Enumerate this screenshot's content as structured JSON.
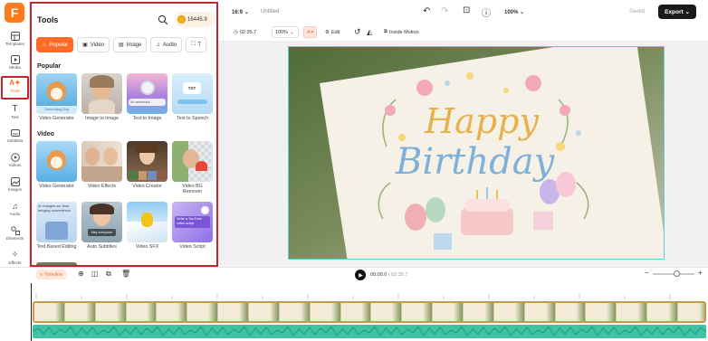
{
  "rail": {
    "items": [
      {
        "label": "Templates",
        "icon": "templates-icon"
      },
      {
        "label": "Media",
        "icon": "media-icon"
      },
      {
        "label": "Tools",
        "icon": "ai-tools-icon"
      },
      {
        "label": "Text",
        "icon": "text-icon"
      },
      {
        "label": "Subtitles",
        "icon": "subtitles-icon"
      },
      {
        "label": "Videos",
        "icon": "videos-icon"
      },
      {
        "label": "Images",
        "icon": "images-icon"
      },
      {
        "label": "Audio",
        "icon": "audio-icon"
      },
      {
        "label": "Elements",
        "icon": "elements-icon"
      },
      {
        "label": "Effects",
        "icon": "effects-icon"
      },
      {
        "label": "Brand",
        "icon": "brand-icon"
      }
    ]
  },
  "tools": {
    "title": "Tools",
    "credits": "16445.9",
    "tabs": [
      "Popular",
      "Video",
      "Image",
      "Audio",
      "T"
    ],
    "popular_label": "Popular",
    "video_label": "Video",
    "popular_cards": [
      {
        "caption": "Video Generator",
        "overlay": "Generating Dog"
      },
      {
        "caption": "Image to Image",
        "overlay": ""
      },
      {
        "caption": "Text to Image",
        "overlay": "An astronaut"
      },
      {
        "caption": "Text to Speech",
        "overlay": "TXT"
      }
    ],
    "video_cards": [
      {
        "caption": "Video Generator",
        "overlay": ""
      },
      {
        "caption": "Video Effects",
        "overlay": ""
      },
      {
        "caption": "Video Creator",
        "overlay": ""
      },
      {
        "caption": "Video BG Remover",
        "overlay": ""
      },
      {
        "caption": "Text Based Editing",
        "overlay": "AI changes our lives, bringing convenience"
      },
      {
        "caption": "Auto Subtitles",
        "overlay": "Hey everyone"
      },
      {
        "caption": "Video SFX",
        "overlay": ""
      },
      {
        "caption": "Video Script",
        "overlay": "Write a YouTube video script"
      }
    ]
  },
  "topbar": {
    "ratio": "16:9",
    "doc_title": "Untitled",
    "zoom": "100%",
    "saved": "Saved",
    "export": "Export"
  },
  "toolbar": {
    "duration": "02:35.7",
    "scale": "100%",
    "edit": "Edit",
    "motion": "Inside Motion"
  },
  "canvas": {
    "line1": "Happy",
    "line2": "Birthday"
  },
  "timeline": {
    "label": "Timeline",
    "current": "00:00.0",
    "separator": "/",
    "total": "02:35.7"
  },
  "colors": {
    "accent": "#ff6a28",
    "highlight": "#c0262d",
    "selection": "#5ed2d2",
    "audio": "#3fc3a2"
  }
}
